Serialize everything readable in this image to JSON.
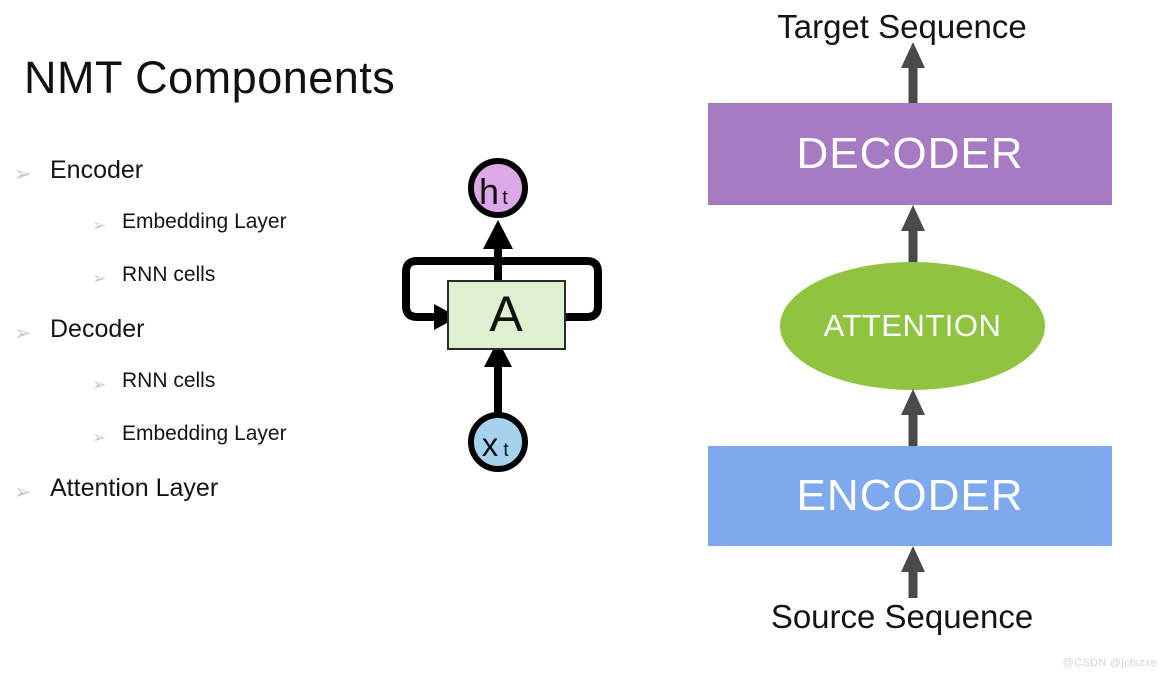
{
  "slide": {
    "title": "NMT Components"
  },
  "outline": {
    "items": [
      {
        "label": "Encoder",
        "level": 1,
        "bullet": "arrowhead-bullet-icon"
      },
      {
        "label": "Embedding Layer",
        "level": 2,
        "bullet": "arrowhead-bullet-icon"
      },
      {
        "label": "RNN cells",
        "level": 2,
        "bullet": "arrowhead-bullet-icon"
      },
      {
        "label": "Decoder",
        "level": 1,
        "bullet": "arrowhead-bullet-icon"
      },
      {
        "label": "RNN cells",
        "level": 2,
        "bullet": "arrowhead-bullet-icon"
      },
      {
        "label": "Embedding Layer",
        "level": 2,
        "bullet": "arrowhead-bullet-icon"
      },
      {
        "label": "Attention Layer",
        "level": 1,
        "bullet": "arrowhead-bullet-icon"
      }
    ],
    "bullet_glyph": "➢",
    "bullet_color": "#c9c9c9"
  },
  "rnn_cell": {
    "output_node": {
      "label": "h",
      "subscript": "t",
      "shape": "circle",
      "color": "#dda8e8",
      "border_color": "#000000"
    },
    "body_node": {
      "label": "A",
      "shape": "rectangle",
      "color": "#ddf0d0",
      "border_color": "#2b2b2b"
    },
    "input_node": {
      "label": "x",
      "subscript": "t",
      "shape": "circle",
      "color": "#a5d2ee",
      "border_color": "#000000"
    },
    "recurrent_loop": "recurrent-loop-arrow",
    "stroke_color": "#000000"
  },
  "architecture": {
    "target_label": "Target Sequence",
    "source_label": "Source Sequence",
    "decoder": {
      "label": "DECODER",
      "color": "#a67bc4",
      "text_color": "#ffffff"
    },
    "attention": {
      "label": "ATTENTION",
      "color": "#90c33f",
      "text_color": "#ffffff"
    },
    "encoder": {
      "label": "ENCODER",
      "color": "#7fa9ed",
      "text_color": "#ffffff"
    },
    "arrow_color": "#4a4a4a",
    "arrows": [
      "arrow-decoder-to-target",
      "arrow-attention-to-decoder",
      "arrow-encoder-to-attention",
      "arrow-source-to-encoder"
    ]
  },
  "watermark": {
    "text": "@CSDN @jcfszxe"
  }
}
